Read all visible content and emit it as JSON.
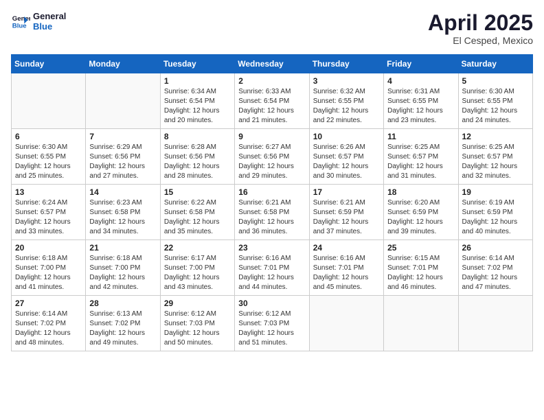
{
  "header": {
    "logo_line1": "General",
    "logo_line2": "Blue",
    "month_title": "April 2025",
    "subtitle": "El Cesped, Mexico"
  },
  "days_of_week": [
    "Sunday",
    "Monday",
    "Tuesday",
    "Wednesday",
    "Thursday",
    "Friday",
    "Saturday"
  ],
  "weeks": [
    [
      {
        "day": "",
        "info": ""
      },
      {
        "day": "",
        "info": ""
      },
      {
        "day": "1",
        "info": "Sunrise: 6:34 AM\nSunset: 6:54 PM\nDaylight: 12 hours\nand 20 minutes."
      },
      {
        "day": "2",
        "info": "Sunrise: 6:33 AM\nSunset: 6:54 PM\nDaylight: 12 hours\nand 21 minutes."
      },
      {
        "day": "3",
        "info": "Sunrise: 6:32 AM\nSunset: 6:55 PM\nDaylight: 12 hours\nand 22 minutes."
      },
      {
        "day": "4",
        "info": "Sunrise: 6:31 AM\nSunset: 6:55 PM\nDaylight: 12 hours\nand 23 minutes."
      },
      {
        "day": "5",
        "info": "Sunrise: 6:30 AM\nSunset: 6:55 PM\nDaylight: 12 hours\nand 24 minutes."
      }
    ],
    [
      {
        "day": "6",
        "info": "Sunrise: 6:30 AM\nSunset: 6:55 PM\nDaylight: 12 hours\nand 25 minutes."
      },
      {
        "day": "7",
        "info": "Sunrise: 6:29 AM\nSunset: 6:56 PM\nDaylight: 12 hours\nand 27 minutes."
      },
      {
        "day": "8",
        "info": "Sunrise: 6:28 AM\nSunset: 6:56 PM\nDaylight: 12 hours\nand 28 minutes."
      },
      {
        "day": "9",
        "info": "Sunrise: 6:27 AM\nSunset: 6:56 PM\nDaylight: 12 hours\nand 29 minutes."
      },
      {
        "day": "10",
        "info": "Sunrise: 6:26 AM\nSunset: 6:57 PM\nDaylight: 12 hours\nand 30 minutes."
      },
      {
        "day": "11",
        "info": "Sunrise: 6:25 AM\nSunset: 6:57 PM\nDaylight: 12 hours\nand 31 minutes."
      },
      {
        "day": "12",
        "info": "Sunrise: 6:25 AM\nSunset: 6:57 PM\nDaylight: 12 hours\nand 32 minutes."
      }
    ],
    [
      {
        "day": "13",
        "info": "Sunrise: 6:24 AM\nSunset: 6:57 PM\nDaylight: 12 hours\nand 33 minutes."
      },
      {
        "day": "14",
        "info": "Sunrise: 6:23 AM\nSunset: 6:58 PM\nDaylight: 12 hours\nand 34 minutes."
      },
      {
        "day": "15",
        "info": "Sunrise: 6:22 AM\nSunset: 6:58 PM\nDaylight: 12 hours\nand 35 minutes."
      },
      {
        "day": "16",
        "info": "Sunrise: 6:21 AM\nSunset: 6:58 PM\nDaylight: 12 hours\nand 36 minutes."
      },
      {
        "day": "17",
        "info": "Sunrise: 6:21 AM\nSunset: 6:59 PM\nDaylight: 12 hours\nand 37 minutes."
      },
      {
        "day": "18",
        "info": "Sunrise: 6:20 AM\nSunset: 6:59 PM\nDaylight: 12 hours\nand 39 minutes."
      },
      {
        "day": "19",
        "info": "Sunrise: 6:19 AM\nSunset: 6:59 PM\nDaylight: 12 hours\nand 40 minutes."
      }
    ],
    [
      {
        "day": "20",
        "info": "Sunrise: 6:18 AM\nSunset: 7:00 PM\nDaylight: 12 hours\nand 41 minutes."
      },
      {
        "day": "21",
        "info": "Sunrise: 6:18 AM\nSunset: 7:00 PM\nDaylight: 12 hours\nand 42 minutes."
      },
      {
        "day": "22",
        "info": "Sunrise: 6:17 AM\nSunset: 7:00 PM\nDaylight: 12 hours\nand 43 minutes."
      },
      {
        "day": "23",
        "info": "Sunrise: 6:16 AM\nSunset: 7:01 PM\nDaylight: 12 hours\nand 44 minutes."
      },
      {
        "day": "24",
        "info": "Sunrise: 6:16 AM\nSunset: 7:01 PM\nDaylight: 12 hours\nand 45 minutes."
      },
      {
        "day": "25",
        "info": "Sunrise: 6:15 AM\nSunset: 7:01 PM\nDaylight: 12 hours\nand 46 minutes."
      },
      {
        "day": "26",
        "info": "Sunrise: 6:14 AM\nSunset: 7:02 PM\nDaylight: 12 hours\nand 47 minutes."
      }
    ],
    [
      {
        "day": "27",
        "info": "Sunrise: 6:14 AM\nSunset: 7:02 PM\nDaylight: 12 hours\nand 48 minutes."
      },
      {
        "day": "28",
        "info": "Sunrise: 6:13 AM\nSunset: 7:02 PM\nDaylight: 12 hours\nand 49 minutes."
      },
      {
        "day": "29",
        "info": "Sunrise: 6:12 AM\nSunset: 7:03 PM\nDaylight: 12 hours\nand 50 minutes."
      },
      {
        "day": "30",
        "info": "Sunrise: 6:12 AM\nSunset: 7:03 PM\nDaylight: 12 hours\nand 51 minutes."
      },
      {
        "day": "",
        "info": ""
      },
      {
        "day": "",
        "info": ""
      },
      {
        "day": "",
        "info": ""
      }
    ]
  ]
}
